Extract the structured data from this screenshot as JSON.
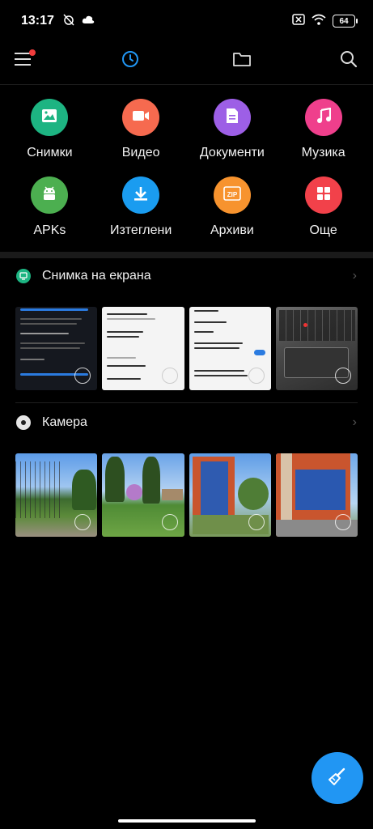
{
  "status": {
    "time": "13:17",
    "battery": "64"
  },
  "toolbar": {
    "menu_icon": "hamburger-icon",
    "recent_icon": "clock-icon",
    "files_icon": "folder-icon",
    "search_icon": "search-icon"
  },
  "categories": [
    {
      "label": "Снимки",
      "color": "#1db482",
      "icon": "image-icon"
    },
    {
      "label": "Видео",
      "color": "#f66a4f",
      "icon": "video-icon"
    },
    {
      "label": "Документи",
      "color": "#9d5fe6",
      "icon": "document-icon"
    },
    {
      "label": "Музика",
      "color": "#ef3f8c",
      "icon": "music-icon"
    },
    {
      "label": "APKs",
      "color": "#4caf50",
      "icon": "android-icon"
    },
    {
      "label": "Изтеглени",
      "color": "#1a9cf0",
      "icon": "download-icon"
    },
    {
      "label": "Архиви",
      "color": "#f7932e",
      "icon": "zip-icon"
    },
    {
      "label": "Още",
      "color": "#f2414a",
      "icon": "grid-icon"
    }
  ],
  "sections": [
    {
      "title": "Снимка на екрана",
      "icon": "screenshot-icon"
    },
    {
      "title": "Камера",
      "icon": "camera-icon"
    }
  ],
  "colors": {
    "accent": "#2196f3",
    "background": "#000000"
  }
}
